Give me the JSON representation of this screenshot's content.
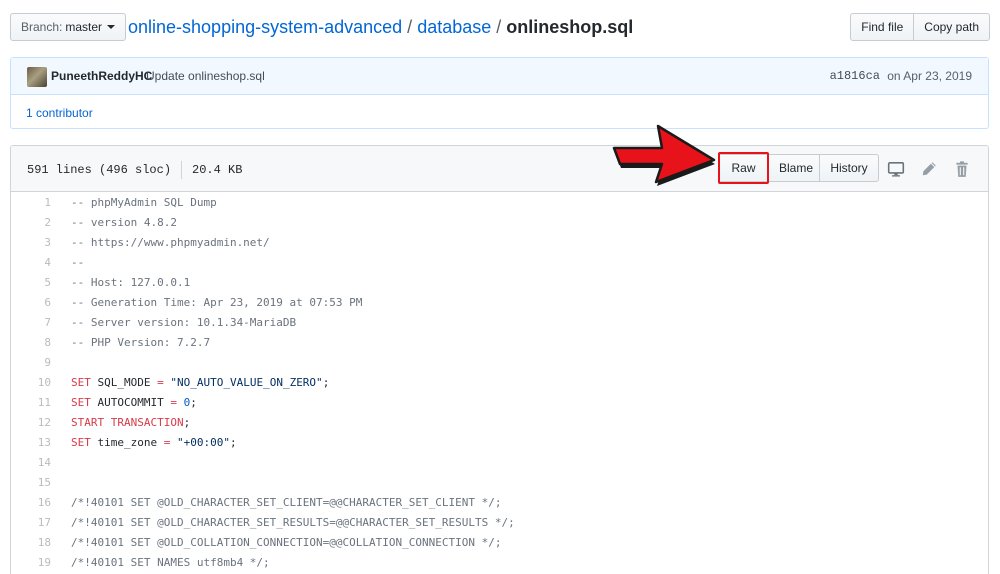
{
  "header": {
    "branch_prefix": "Branch:",
    "branch_name": "master",
    "repo_link": "online-shopping-system-advanced",
    "folder_link": "database",
    "file_name": "onlineshop.sql",
    "sep": "/",
    "find_file": "Find file",
    "copy_path": "Copy path"
  },
  "commit": {
    "author": "PuneethReddyHC",
    "message": "Update onlineshop.sql",
    "sha": "a1816ca",
    "date": "on Apr 23, 2019",
    "contributors": "1 contributor"
  },
  "file": {
    "lines_info": "591 lines (496 sloc)",
    "size": "20.4 KB",
    "raw": "Raw",
    "blame": "Blame",
    "history": "History"
  },
  "code": [
    {
      "n": "1",
      "t": "-- phpMyAdmin SQL Dump"
    },
    {
      "n": "2",
      "t": "-- version 4.8.2"
    },
    {
      "n": "3",
      "t": "-- https://www.phpmyadmin.net/"
    },
    {
      "n": "4",
      "t": "--"
    },
    {
      "n": "5",
      "t": "-- Host: 127.0.0.1"
    },
    {
      "n": "6",
      "t": "-- Generation Time: Apr 23, 2019 at 07:53 PM"
    },
    {
      "n": "7",
      "t": "-- Server version: 10.1.34-MariaDB"
    },
    {
      "n": "8",
      "t": "-- PHP Version: 7.2.7"
    },
    {
      "n": "9",
      "t": ""
    },
    {
      "n": "10",
      "t": "SET SQL_MODE = \"NO_AUTO_VALUE_ON_ZERO\";"
    },
    {
      "n": "11",
      "t": "SET AUTOCOMMIT = 0;"
    },
    {
      "n": "12",
      "t": "START TRANSACTION;"
    },
    {
      "n": "13",
      "t": "SET time_zone = \"+00:00\";"
    },
    {
      "n": "14",
      "t": ""
    },
    {
      "n": "15",
      "t": ""
    },
    {
      "n": "16",
      "t": "/*!40101 SET @OLD_CHARACTER_SET_CLIENT=@@CHARACTER_SET_CLIENT */;"
    },
    {
      "n": "17",
      "t": "/*!40101 SET @OLD_CHARACTER_SET_RESULTS=@@CHARACTER_SET_RESULTS */;"
    },
    {
      "n": "18",
      "t": "/*!40101 SET @OLD_COLLATION_CONNECTION=@@COLLATION_CONNECTION */;"
    },
    {
      "n": "19",
      "t": "/*!40101 SET NAMES utf8mb4 */;"
    }
  ],
  "icons": {
    "desktop": "desktop-icon",
    "pencil": "pencil-icon",
    "trash": "trash-icon",
    "arrow": "red-arrow-annotation"
  },
  "colors": {
    "link": "#0366d6",
    "highlight": "#e8121b",
    "keyword": "#d73a49"
  }
}
